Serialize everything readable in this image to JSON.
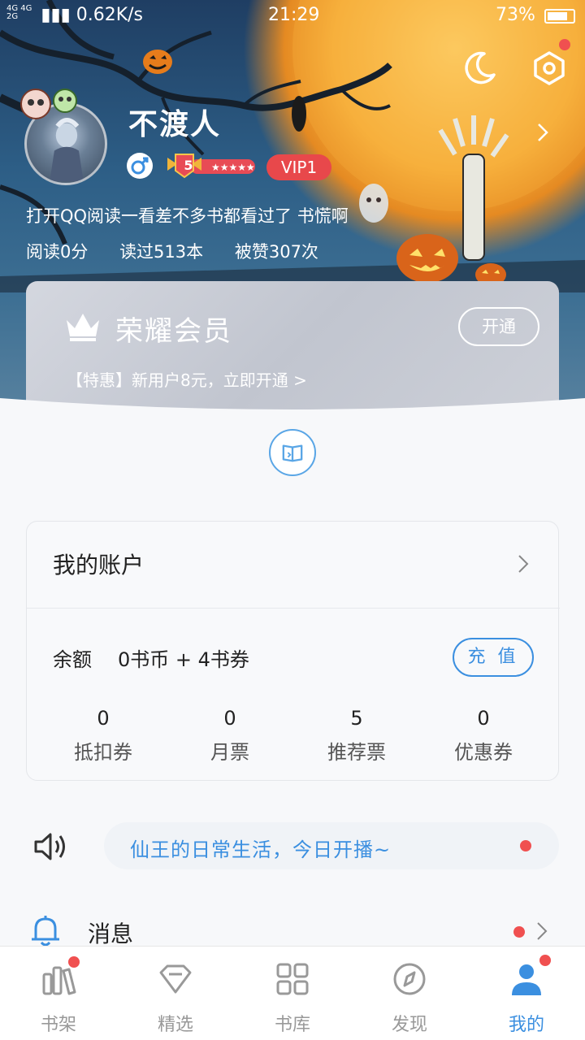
{
  "status_bar": {
    "network_small_top": "4G 4G",
    "network_small_bottom": "2G",
    "speed": "0.62K/s",
    "time": "21:29",
    "battery": "73%"
  },
  "profile": {
    "username": "不渡人",
    "level": "5",
    "vip": "VIP1",
    "signature": "打开QQ阅读一看差不多书都看过了 书慌啊",
    "stats": [
      "阅读0分",
      "读过513本",
      "被赞307次"
    ]
  },
  "vip_card": {
    "title": "荣耀会员",
    "open_label": "开通",
    "promo": "【特惠】新用户8元，立即开通 >"
  },
  "account": {
    "title": "我的账户",
    "balance_label": "余额",
    "balance_value": "0书币 + 4书券",
    "recharge_label": "充 值",
    "tickets": [
      {
        "value": "0",
        "label": "抵扣券"
      },
      {
        "value": "0",
        "label": "月票"
      },
      {
        "value": "5",
        "label": "推荐票"
      },
      {
        "value": "0",
        "label": "优惠券"
      }
    ]
  },
  "broadcast": {
    "text": "仙王的日常生活，今日开播~"
  },
  "messages": {
    "label": "消息"
  },
  "tabs": [
    {
      "label": "书架",
      "icon": "bookshelf-icon",
      "badge": true
    },
    {
      "label": "精选",
      "icon": "diamond-icon",
      "badge": false
    },
    {
      "label": "书库",
      "icon": "grid-icon",
      "badge": false
    },
    {
      "label": "发现",
      "icon": "compass-icon",
      "badge": false
    },
    {
      "label": "我的",
      "icon": "user-icon",
      "badge": true,
      "active": true
    }
  ],
  "colors": {
    "accent": "#3b8fe0",
    "badge_red": "#f05050",
    "vip_red": "#e8484b"
  }
}
